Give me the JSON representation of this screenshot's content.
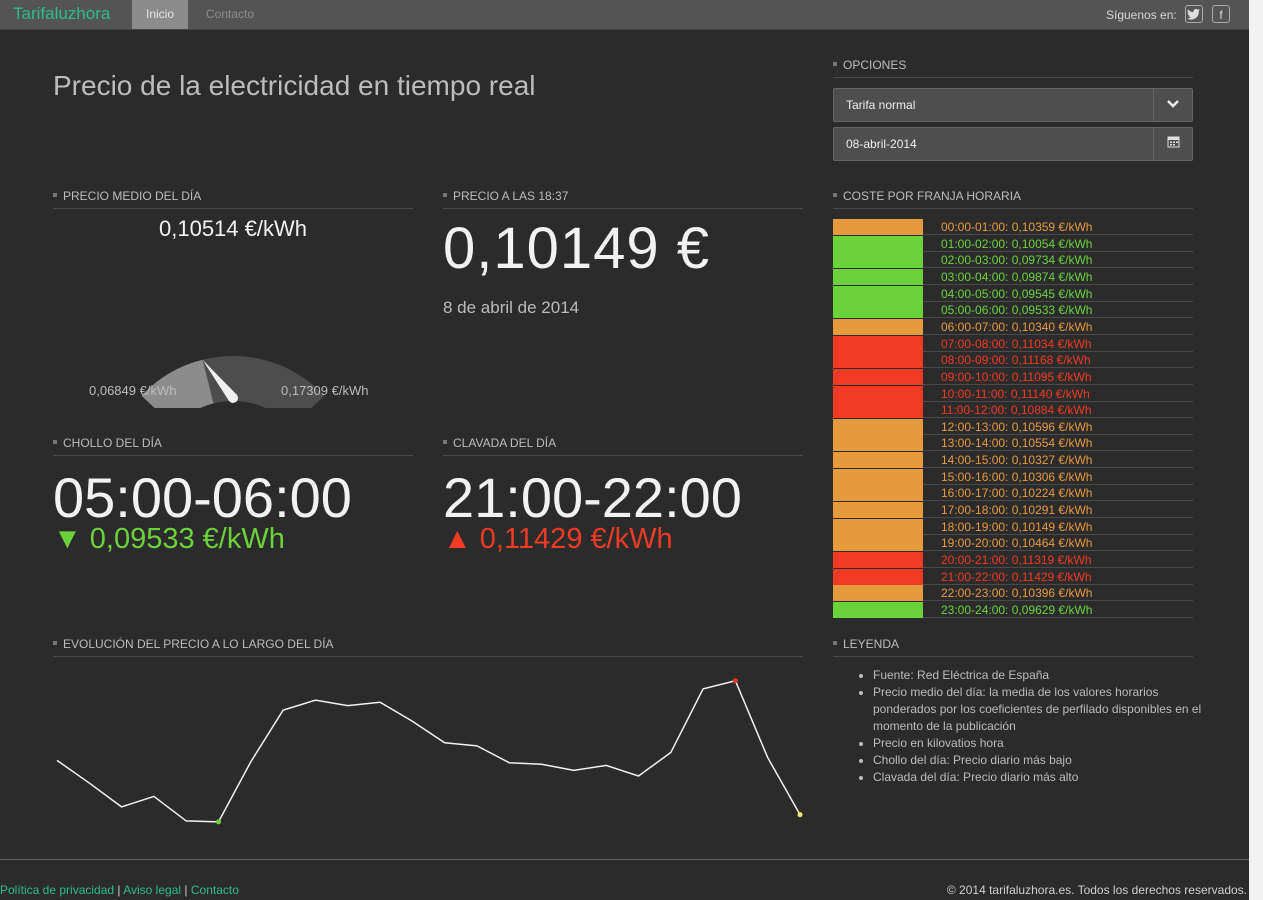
{
  "header": {
    "brand": "Tarifaluzhora",
    "nav": [
      "Inicio",
      "Contacto"
    ],
    "follow_label": "Síguenos en:",
    "social_icons": [
      "twitter-icon",
      "facebook-icon"
    ]
  },
  "page_title": "Precio de la electricidad en tiempo real",
  "options": {
    "heading": "OPCIONES",
    "tariff": "Tarifa normal",
    "date": "08-abril-2014"
  },
  "avg": {
    "heading": "PRECIO MEDIO DEL DÍA",
    "value": "0,10514 €/kWh",
    "min": "0,06849 €/kWh",
    "max": "0,17309 €/kWh",
    "gauge_level": 0.35
  },
  "current": {
    "heading": "PRECIO A LAS 18:37",
    "value": "0,10149 €",
    "date": "8 de abril de 2014"
  },
  "cheapest": {
    "heading": "CHOLLO DEL DÍA",
    "range": "05:00-06:00",
    "price": "0,09533 €/kWh"
  },
  "priciest": {
    "heading": "CLAVADA DEL DÍA",
    "range": "21:00-22:00",
    "price": "0,11429 €/kWh"
  },
  "hourly": {
    "heading": "COSTE POR FRANJA HORARIA",
    "colors": {
      "green": "#6cd23c",
      "orange": "#e69a3e",
      "red": "#f23b24"
    },
    "rows": [
      {
        "label": "00:00-01:00: 0,10359 €/kWh",
        "level": "orange"
      },
      {
        "label": "01:00-02:00: 0,10054 €/kWh",
        "level": "green"
      },
      {
        "label": "02:00-03:00: 0,09734 €/kWh",
        "level": "green"
      },
      {
        "label": "03:00-04:00: 0,09874 €/kWh",
        "level": "green"
      },
      {
        "label": "04:00-05:00: 0,09545 €/kWh",
        "level": "green"
      },
      {
        "label": "05:00-06:00: 0,09533 €/kWh",
        "level": "green"
      },
      {
        "label": "06:00-07:00: 0,10340 €/kWh",
        "level": "orange"
      },
      {
        "label": "07:00-08:00: 0,11034 €/kWh",
        "level": "red"
      },
      {
        "label": "08:00-09:00: 0,11168 €/kWh",
        "level": "red"
      },
      {
        "label": "09:00-10:00: 0,11095 €/kWh",
        "level": "red"
      },
      {
        "label": "10:00-11:00: 0,11140 €/kWh",
        "level": "red"
      },
      {
        "label": "11:00-12:00: 0,10884 €/kWh",
        "level": "red"
      },
      {
        "label": "12:00-13:00: 0,10596 €/kWh",
        "level": "orange"
      },
      {
        "label": "13:00-14:00: 0,10554 €/kWh",
        "level": "orange"
      },
      {
        "label": "14:00-15:00: 0,10327 €/kWh",
        "level": "orange"
      },
      {
        "label": "15:00-16:00: 0,10306 €/kWh",
        "level": "orange"
      },
      {
        "label": "16:00-17:00: 0,10224 €/kWh",
        "level": "orange"
      },
      {
        "label": "17:00-18:00: 0,10291 €/kWh",
        "level": "orange"
      },
      {
        "label": "18:00-19:00: 0,10149 €/kWh",
        "level": "orange"
      },
      {
        "label": "19:00-20:00: 0,10464 €/kWh",
        "level": "orange"
      },
      {
        "label": "20:00-21:00: 0,11319 €/kWh",
        "level": "red"
      },
      {
        "label": "21:00-22:00: 0,11429 €/kWh",
        "level": "red"
      },
      {
        "label": "22:00-23:00: 0,10396 €/kWh",
        "level": "orange"
      },
      {
        "label": "23:00-24:00: 0,09629 €/kWh",
        "level": "green"
      }
    ]
  },
  "evolution": {
    "heading": "EVOLUCIÓN DEL PRECIO A LO LARGO DEL DÍA"
  },
  "chart_data": {
    "type": "line",
    "x": [
      0,
      1,
      2,
      3,
      4,
      5,
      6,
      7,
      8,
      9,
      10,
      11,
      12,
      13,
      14,
      15,
      16,
      17,
      18,
      19,
      20,
      21,
      22,
      23
    ],
    "values": [
      0.10359,
      0.10054,
      0.09734,
      0.09874,
      0.09545,
      0.09533,
      0.1034,
      0.11034,
      0.11168,
      0.11095,
      0.1114,
      0.10884,
      0.10596,
      0.10554,
      0.10327,
      0.10306,
      0.10224,
      0.10291,
      0.10149,
      0.10464,
      0.11319,
      0.11429,
      0.10396,
      0.09629
    ],
    "ylim": [
      0.0945,
      0.116
    ],
    "grid": false,
    "highlights": {
      "min_index": 5,
      "max_index": 21,
      "current_index": 23
    },
    "line_color": "#f2f2f2"
  },
  "legend": {
    "heading": "LEYENDA",
    "items": [
      "Fuente: Red Eléctrica de España",
      "Precio medio del día: la media de los valores horarios ponderados por los coeficientes de perfilado disponibles en el momento de la publicación",
      "Precio en kilovatios hora",
      "Chollo del día: Precio diario más bajo",
      "Clavada del día: Precio diario más alto"
    ]
  },
  "footer": {
    "links": [
      "Política de privacidad",
      "Aviso legal",
      "Contacto"
    ],
    "separator": "|",
    "copyright": "© 2014 tarifaluzhora.es. Todos los derechos reservados."
  }
}
